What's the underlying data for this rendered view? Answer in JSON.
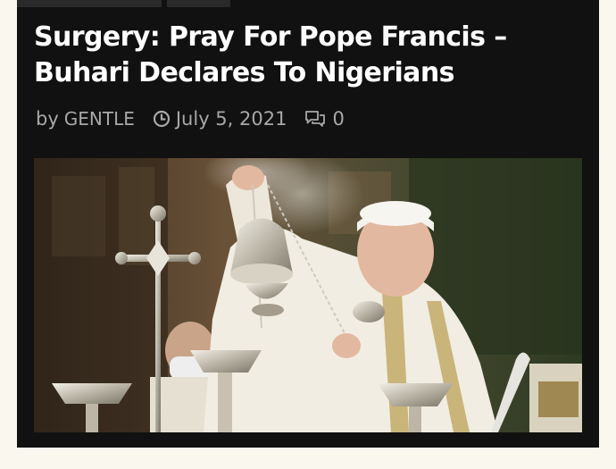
{
  "article": {
    "title": "Surgery: Pray For Pope Francis – Buhari Declares To Nigerians",
    "byline_prefix": "by",
    "author": "GENTLE",
    "date": "July 5, 2021",
    "comment_count": "0",
    "icons": {
      "date": "clock-icon",
      "comments": "comment-bubbles-icon"
    },
    "image_alt": ""
  },
  "colors": {
    "page_background": "#faf7ee",
    "card_background": "#111111",
    "title_text": "#ffffff",
    "meta_text": "#a8a8a8"
  }
}
